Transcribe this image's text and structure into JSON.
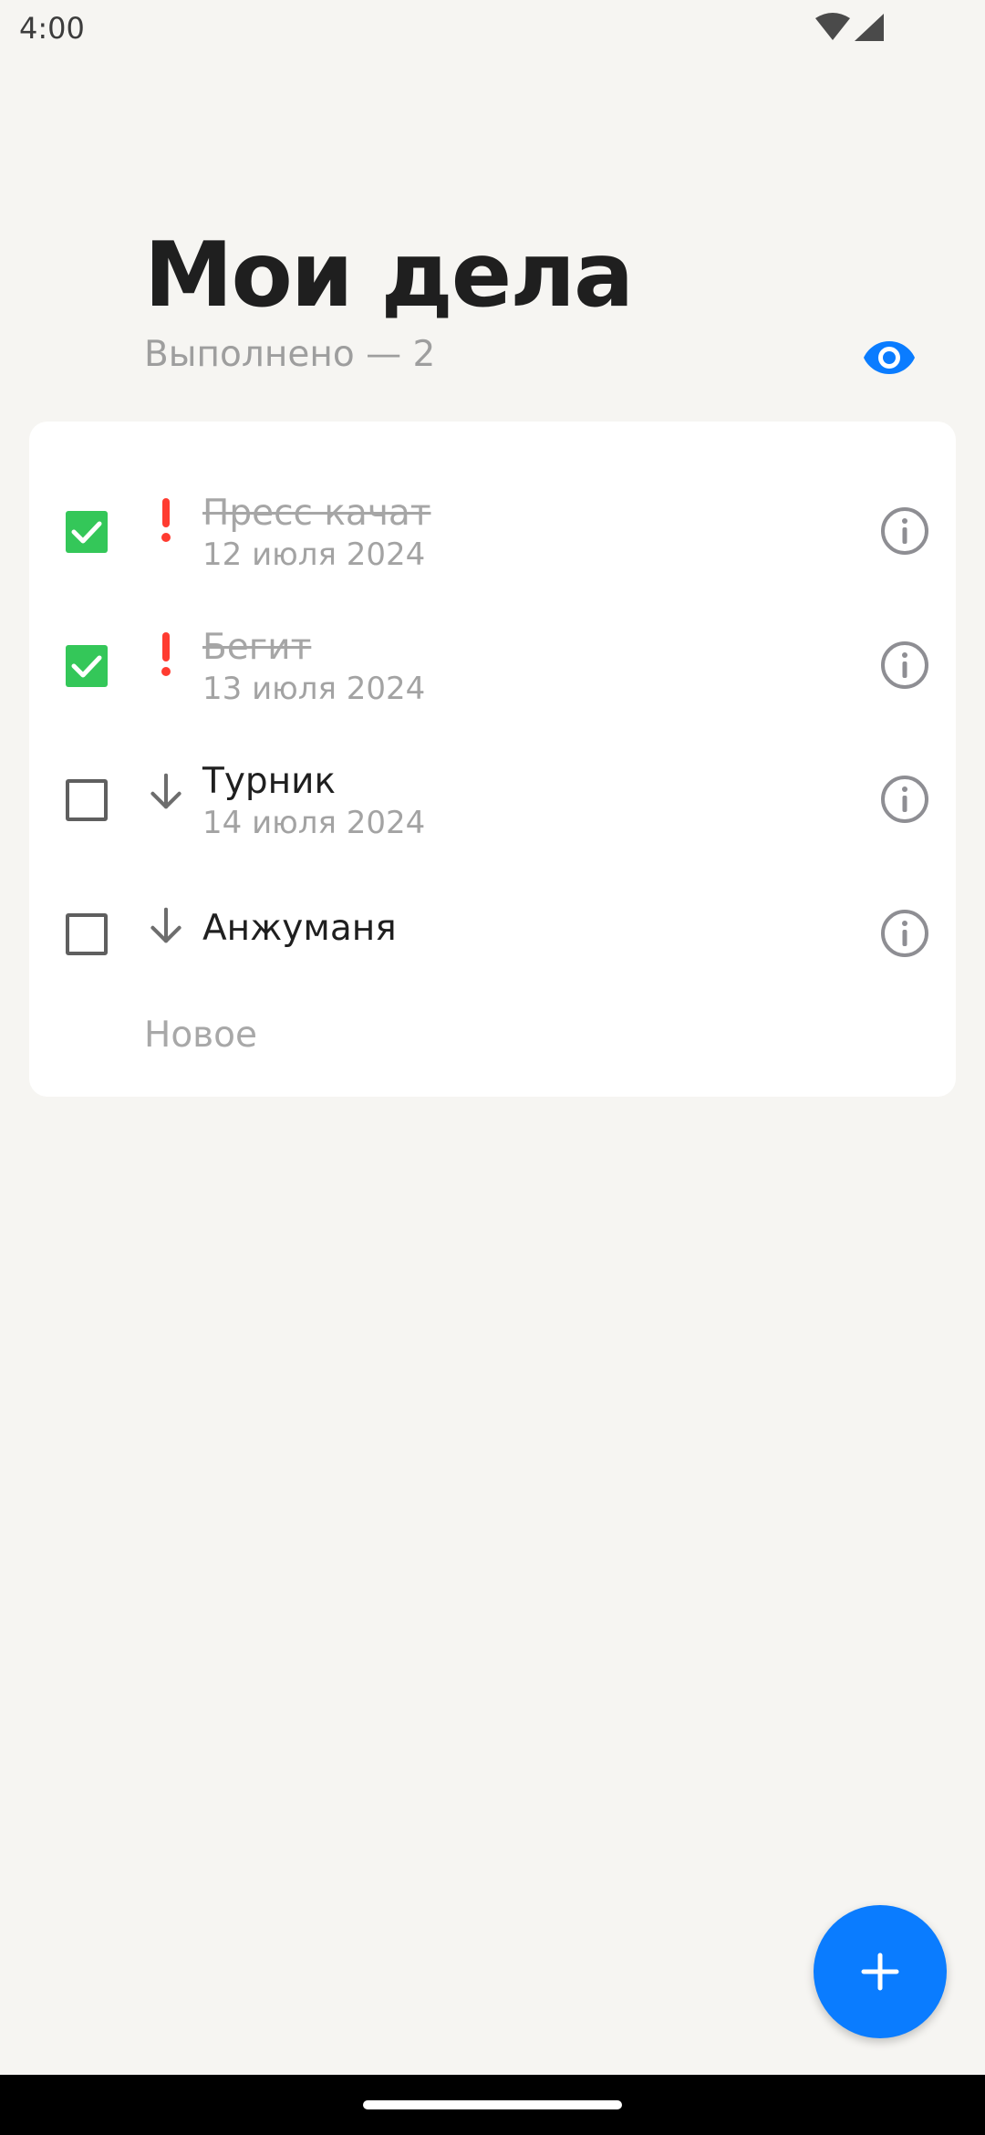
{
  "status_bar": {
    "time": "4:00"
  },
  "header": {
    "title": "Мои дела",
    "completed_label": "Выполнено — 2"
  },
  "colors": {
    "accent": "#0a7cff",
    "checked": "#34c759",
    "priority_high": "#ff3b30",
    "background": "#f6f5f2"
  },
  "tasks": [
    {
      "text": "Пресс качат",
      "date": "12 июля 2024",
      "done": true,
      "priority": "high"
    },
    {
      "text": "Бегит",
      "date": "13 июля 2024",
      "done": true,
      "priority": "high"
    },
    {
      "text": "Турник",
      "date": "14 июля 2024",
      "done": false,
      "priority": "low"
    },
    {
      "text": "Анжуманя",
      "date": "",
      "done": false,
      "priority": "low"
    }
  ],
  "new_item_label": "Новое",
  "icons": {
    "visibility": "eye-icon",
    "info": "info-icon",
    "high_priority": "exclamation-icon",
    "low_priority": "arrow-down-icon",
    "add": "plus-icon"
  }
}
